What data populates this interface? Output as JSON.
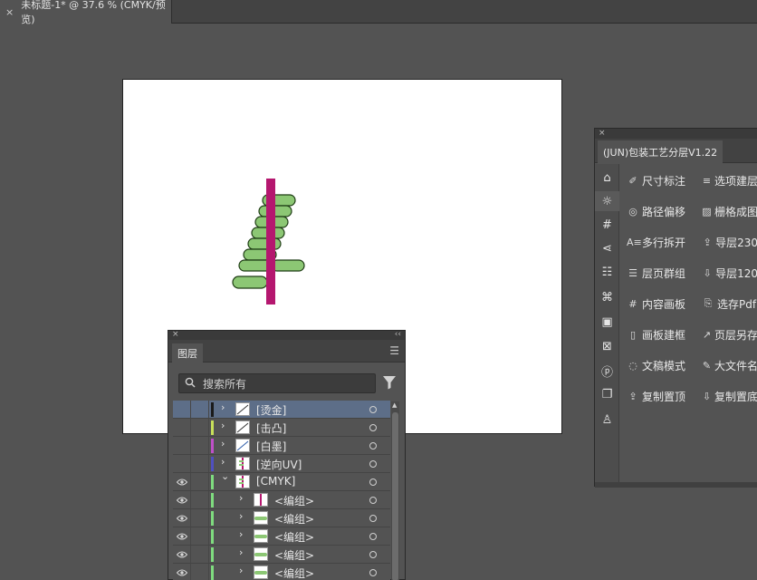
{
  "document_tab": {
    "close_glyph": "×",
    "title": "未标题-1* @ 37.6 % (CMYK/预览)"
  },
  "layers_panel": {
    "close_glyph": "×",
    "collapse_glyph": "‹‹",
    "tab_label": "图层",
    "menu_icon": "hamburger-menu-icon",
    "search_placeholder": "搜索所有",
    "search_icon": "search-icon",
    "filter_icon": "filter-icon",
    "layers": [
      {
        "name": "[烫金]",
        "color": "#1a1a1a",
        "visible": false,
        "expanded": false,
        "indent": 0,
        "selected": true,
        "thumb": "line"
      },
      {
        "name": "[击凸]",
        "color": "#c8e05a",
        "visible": false,
        "expanded": false,
        "indent": 0,
        "selected": false,
        "thumb": "line"
      },
      {
        "name": "[白墨]",
        "color": "#c050c8",
        "visible": false,
        "expanded": false,
        "indent": 0,
        "selected": false,
        "thumb": "line-blue"
      },
      {
        "name": "[逆向UV]",
        "color": "#5050c0",
        "visible": false,
        "expanded": false,
        "indent": 0,
        "selected": false,
        "thumb": "figure"
      },
      {
        "name": "[CMYK]",
        "color": "#7fdc7f",
        "visible": true,
        "expanded": true,
        "indent": 0,
        "selected": false,
        "thumb": "figure"
      },
      {
        "name": "<编组>",
        "color": "#7fdc7f",
        "visible": true,
        "expanded": false,
        "indent": 1,
        "selected": false,
        "thumb": "magenta"
      },
      {
        "name": "<编组>",
        "color": "#7fdc7f",
        "visible": true,
        "expanded": false,
        "indent": 1,
        "selected": false,
        "thumb": "green"
      },
      {
        "name": "<编组>",
        "color": "#7fdc7f",
        "visible": true,
        "expanded": false,
        "indent": 1,
        "selected": false,
        "thumb": "green"
      },
      {
        "name": "<编组>",
        "color": "#7fdc7f",
        "visible": true,
        "expanded": false,
        "indent": 1,
        "selected": false,
        "thumb": "green"
      },
      {
        "name": "<编组>",
        "color": "#7fdc7f",
        "visible": true,
        "expanded": false,
        "indent": 1,
        "selected": false,
        "thumb": "green"
      }
    ]
  },
  "plugin_panel": {
    "close_glyph": "×",
    "title": "(JUN)包装工艺分层V1.22",
    "sidebar_icons": [
      "home-icon",
      "sun-icon",
      "hash-icon",
      "share-icon",
      "list-icon",
      "command-icon",
      "save-icon",
      "image-x-icon",
      "p-box-icon",
      "copy-box-icon",
      "stamp-icon"
    ],
    "buttons": [
      {
        "icon": "ruler-icon",
        "glyph": "✐",
        "label": "尺寸标注"
      },
      {
        "icon": "layers-icon",
        "glyph": "≡",
        "label": "选项建层"
      },
      {
        "icon": "target-icon",
        "glyph": "◎",
        "label": "路径偏移"
      },
      {
        "icon": "image-icon",
        "glyph": "▨",
        "label": "栅格成图"
      },
      {
        "icon": "text-split-icon",
        "glyph": "A≡",
        "label": "多行拆开"
      },
      {
        "icon": "upload-icon",
        "glyph": "⇪",
        "label": "导层230"
      },
      {
        "icon": "list-icon",
        "glyph": "☰",
        "label": "层页群组"
      },
      {
        "icon": "download-icon",
        "glyph": "⇩",
        "label": "导层120"
      },
      {
        "icon": "hash-icon",
        "glyph": "#",
        "label": "内容画板"
      },
      {
        "icon": "file-icon",
        "glyph": "⎘",
        "label": "选存Pdf"
      },
      {
        "icon": "page-icon",
        "glyph": "▯",
        "label": "画板建框"
      },
      {
        "icon": "trend-icon",
        "glyph": "↗",
        "label": "页层另存"
      },
      {
        "icon": "mode-icon",
        "glyph": "◌",
        "label": "文稿模式"
      },
      {
        "icon": "brush-icon",
        "glyph": "✎",
        "label": "大文件名"
      },
      {
        "icon": "upload-icon",
        "glyph": "⇪",
        "label": "复制置顶"
      },
      {
        "icon": "download-icon",
        "glyph": "⇩",
        "label": "复制置底"
      }
    ]
  },
  "colors": {
    "workspace": "#535353",
    "artboard": "#ffffff",
    "magenta_bar": "#b5176f",
    "green_pill": "#8cc774",
    "selected_row": "#5d6e88"
  }
}
